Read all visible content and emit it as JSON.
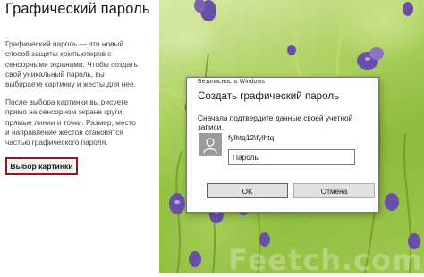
{
  "left_panel": {
    "title": "Графический пароль",
    "description_1_lines": [
      "Графический пароль — это новый",
      "способ защиты компьютеров с",
      "сенсорными экранами. Чтобы создать",
      "свой уникальный пароль, вы",
      "выбираете картинку и жесты для нее."
    ],
    "description_2_lines": [
      "После выбора картинки вы рисуете",
      "прямо на сенсорном экране круги,",
      "прямые линии и точки. Размер, место",
      "и направление жестов становятся",
      "частью графического пароля."
    ],
    "choose_button_label": "Выбор картинки"
  },
  "dialog": {
    "caption": "Безопасность Windows",
    "title": "Создать графический пароль",
    "prompt": "Сначала подтвердите данные своей учетной записи.",
    "account_name": "fylhtq12\\fylhtq",
    "password_value": "Пароль",
    "ok_label": "OK",
    "cancel_label": "Отмена"
  },
  "watermark": "Feetch.com",
  "colors": {
    "accent_button_border": "#8a1c22",
    "ok_focus_border": "#0078d7",
    "avatar_bg": "#9b9b9b"
  },
  "icons": {
    "avatar": "user-silhouette-icon"
  }
}
